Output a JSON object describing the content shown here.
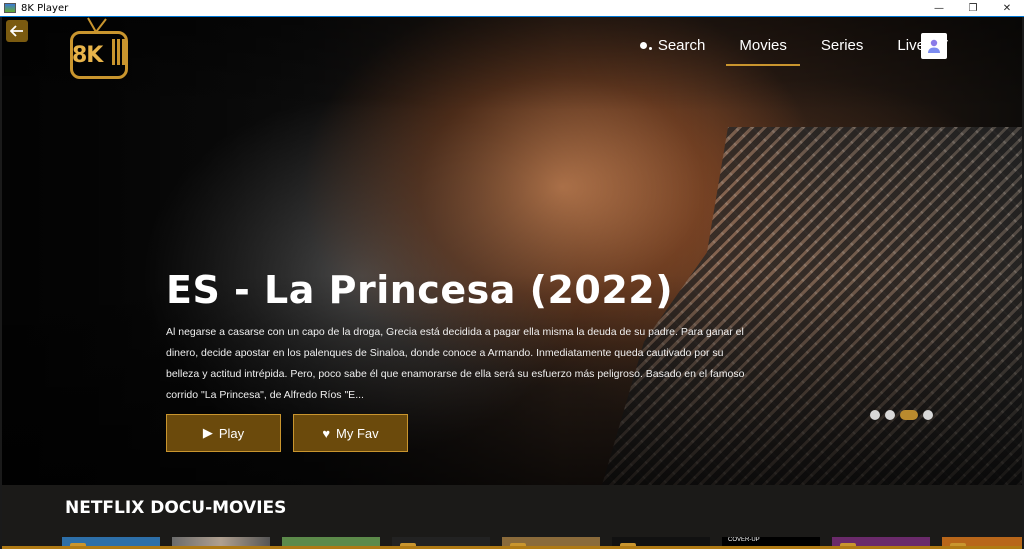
{
  "window": {
    "title": "8K Player",
    "minimize_glyph": "—",
    "restore_glyph": "❐",
    "close_glyph": "✕"
  },
  "header": {
    "logo_text": "8K",
    "nav": [
      {
        "label": "Search",
        "icon": "search-dots-icon"
      },
      {
        "label": "Movies",
        "active": true
      },
      {
        "label": "Series"
      },
      {
        "label": "Live TV"
      }
    ],
    "avatar_icon": "user-avatar-icon"
  },
  "hero": {
    "title": "ES - La Princesa (2022)",
    "description": "Al negarse a casarse con un capo de la droga, Grecia está decidida a pagar ella misma la deuda de su padre. Para ganar el dinero, decide apostar en los palenques de Sinaloa, donde conoce a Armando. Inmediatamente queda cautivado por su belleza y actitud intrépida. Pero, poco sabe él que enamorarse de ella será su esfuerzo más peligroso. Basado en el famoso corrido \"La Princesa\", de Alfredo Ríos \"E...",
    "play_label": "Play",
    "fav_label": "My Fav",
    "carousel": {
      "count": 4,
      "active_index": 2
    }
  },
  "row": {
    "title": "NETFLIX DOCU-MOVIES",
    "thumbs": [
      {
        "caption": ""
      },
      {
        "caption": ""
      },
      {
        "caption": ""
      },
      {
        "caption": ""
      },
      {
        "caption": ""
      },
      {
        "caption": ""
      },
      {
        "caption": "COVER-UP"
      },
      {
        "caption": ""
      },
      {
        "caption": ""
      }
    ]
  },
  "colors": {
    "accent": "#c9952e",
    "button_bg": "#6b4a0c",
    "titlebar_border": "#0078d7"
  }
}
